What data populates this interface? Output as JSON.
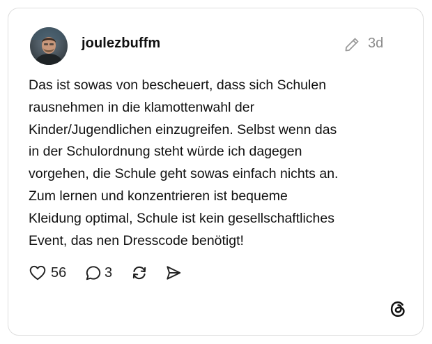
{
  "post": {
    "username": "joulezbuffm",
    "timestamp": "3d",
    "text": "Das ist sowas von bescheuert, dass sich Schulen\nrausnehmen in die klamottenwahl der\nKinder/Jugendlichen einzugreifen. Selbst wenn das\nin der Schulordnung steht würde ich dagegen\nvorgehen, die Schule geht sowas einfach nichts an.\nZum lernen und konzentrieren ist bequeme\nKleidung optimal, Schule ist kein gesellschaftliches\nEvent, das nen Dresscode benötigt!"
  },
  "actions": {
    "likes": "56",
    "replies": "3"
  },
  "icons": {
    "edit": "pencil-icon",
    "like": "heart-icon",
    "reply": "speech-bubble-icon",
    "repost": "repost-icon",
    "share": "send-icon",
    "brand": "threads-logo"
  },
  "colors": {
    "text": "#101010",
    "muted": "#8a8a8a",
    "border": "#dedede"
  }
}
